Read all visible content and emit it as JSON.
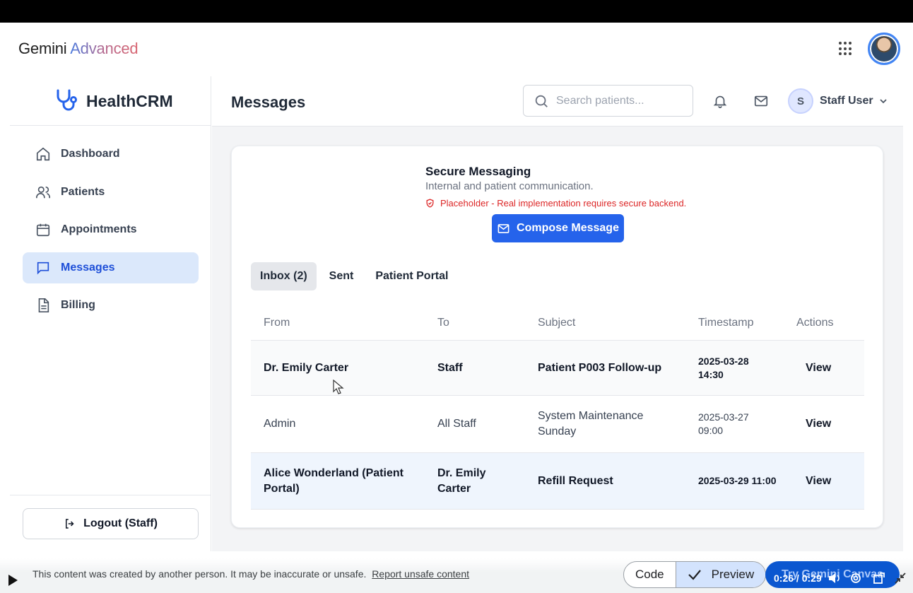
{
  "gemini": {
    "brand_prefix": "Gemini",
    "brand_suffix": "Advanced"
  },
  "app": {
    "logo_text": "HealthCRM",
    "page_title": "Messages"
  },
  "sidebar": {
    "items": [
      {
        "label": "Dashboard",
        "icon": "home-icon"
      },
      {
        "label": "Patients",
        "icon": "users-icon"
      },
      {
        "label": "Appointments",
        "icon": "calendar-icon"
      },
      {
        "label": "Messages",
        "icon": "message-icon",
        "active": true
      },
      {
        "label": "Billing",
        "icon": "document-icon"
      }
    ],
    "logout_label": "Logout (Staff)"
  },
  "header": {
    "search_placeholder": "Search patients...",
    "user_initial": "S",
    "user_name": "Staff User"
  },
  "messaging": {
    "title": "Secure Messaging",
    "subtitle": "Internal and patient communication.",
    "warning": "Placeholder - Real implementation requires secure backend.",
    "compose_label": "Compose Message"
  },
  "tabs": [
    {
      "label": "Inbox (2)",
      "active": true
    },
    {
      "label": "Sent"
    },
    {
      "label": "Patient Portal"
    }
  ],
  "table": {
    "columns": [
      "From",
      "To",
      "Subject",
      "Timestamp",
      "Actions"
    ],
    "rows": [
      {
        "from": "Dr. Emily Carter",
        "to": "Staff",
        "subject": "Patient P003 Follow-up",
        "timestamp": "2025-03-28 14:30",
        "action": "View",
        "unread": true
      },
      {
        "from": "Admin",
        "to": "All Staff",
        "subject": "System Maintenance Sunday",
        "timestamp": "2025-03-27 09:00",
        "action": "View",
        "unread": false
      },
      {
        "from": "Alice Wonderland (Patient Portal)",
        "to": "Dr. Emily Carter",
        "subject": "Refill Request",
        "timestamp": "2025-03-29 11:00",
        "action": "View",
        "unread": true
      }
    ]
  },
  "video_bar": {
    "disclaimer": "This content was created by another person. It may be inaccurate or unsafe.",
    "report_link": "Report unsafe content",
    "code_label": "Code",
    "preview_label": "Preview",
    "try_label": "Try Gemini Canvas",
    "time": "0:26 / 0:29"
  },
  "colors": {
    "primary": "#2563eb",
    "active_nav_bg": "#dbe8fb",
    "warning": "#dc2626"
  }
}
